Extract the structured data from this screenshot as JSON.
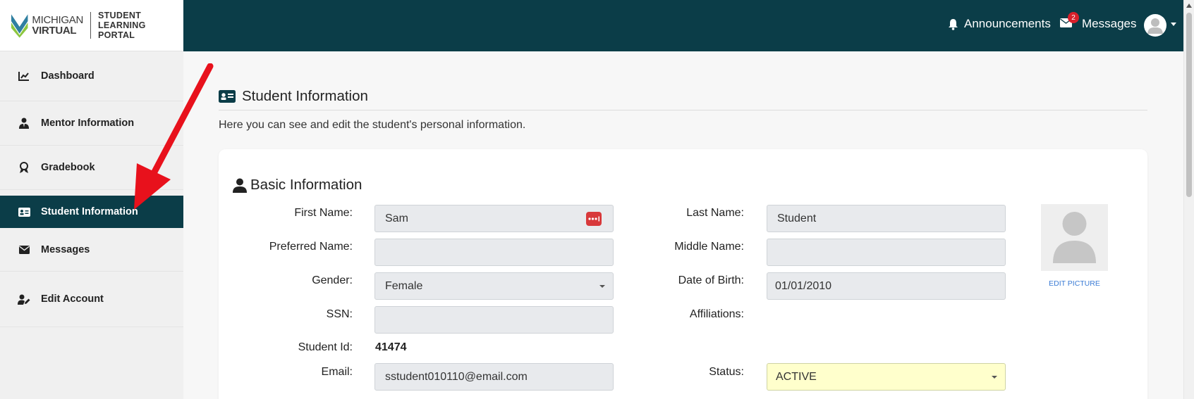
{
  "logo": {
    "line1": "MICHIGAN",
    "line2": "VIRTUAL",
    "portal_line1": "STUDENT",
    "portal_line2": "LEARNING PORTAL"
  },
  "sidebar": {
    "items": [
      {
        "label": "Dashboard",
        "icon": "chart-line-icon",
        "active": false
      },
      {
        "label": "Mentor Information",
        "icon": "user-tie-icon",
        "active": false
      },
      {
        "label": "Gradebook",
        "icon": "award-icon",
        "active": false
      },
      {
        "label": "Student Information",
        "icon": "id-card-icon",
        "active": true
      },
      {
        "label": "Messages",
        "icon": "envelope-icon",
        "active": false
      },
      {
        "label": "Edit Account",
        "icon": "user-edit-icon",
        "active": false
      }
    ]
  },
  "header": {
    "announcements_label": "Announcements",
    "messages_label": "Messages",
    "messages_badge": "2"
  },
  "page": {
    "title": "Student Information",
    "description": "Here you can see and edit the student's personal information."
  },
  "basic_info": {
    "title": "Basic Information",
    "first_name_label": "First Name:",
    "first_name": "Sam",
    "last_name_label": "Last Name:",
    "last_name": "Student",
    "preferred_name_label": "Preferred Name:",
    "preferred_name": "",
    "middle_name_label": "Middle Name:",
    "middle_name": "",
    "gender_label": "Gender:",
    "gender": "Female",
    "dob_label": "Date of Birth:",
    "dob": "01/01/2010",
    "ssn_label": "SSN:",
    "ssn": "",
    "affiliations_label": "Affiliations:",
    "student_id_label": "Student Id:",
    "student_id": "41474",
    "email_label": "Email:",
    "email": "sstudent010110@email.com",
    "status_label": "Status:",
    "status": "ACTIVE",
    "edit_picture_label": "EDIT PICTURE"
  },
  "colors": {
    "brand_dark": "#0b3d48",
    "badge_red": "#d9202b",
    "link_blue": "#3a7bd5",
    "status_yellow": "#ffffcc"
  }
}
